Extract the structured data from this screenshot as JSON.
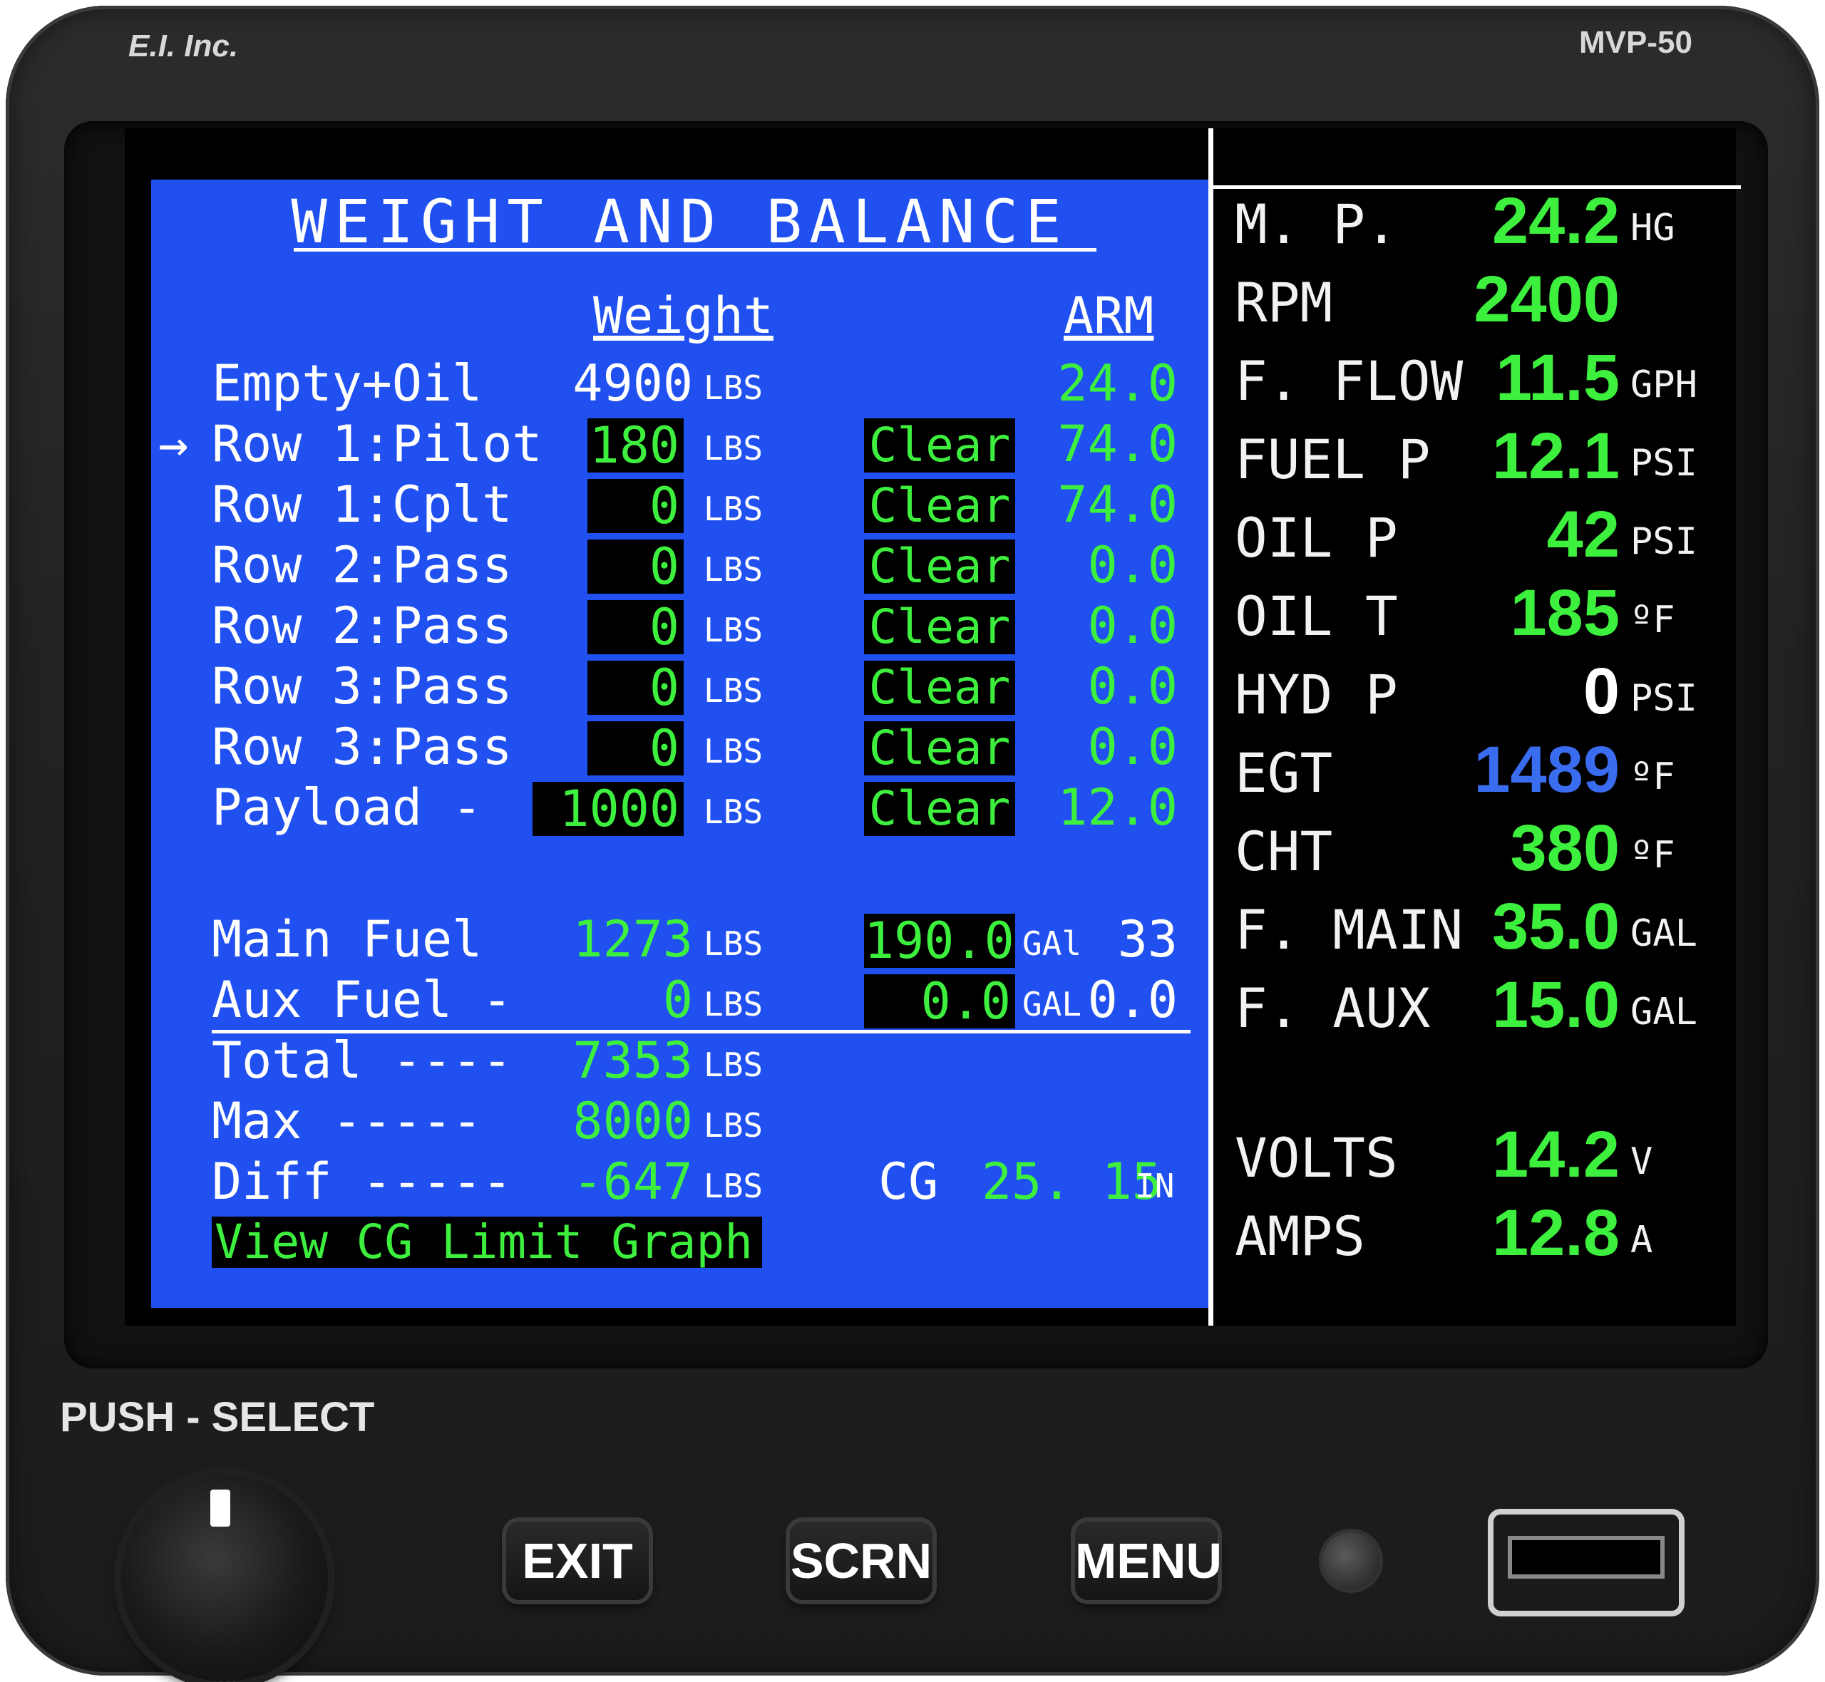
{
  "device": {
    "brand": "E.I. Inc.",
    "model": "MVP-50"
  },
  "wb": {
    "title": "WEIGHT AND BALANCE",
    "col_weight": "Weight",
    "col_arm": "ARM",
    "unit_lbs": "LBS",
    "rows": [
      {
        "label": "Empty+Oil",
        "weight": "4900",
        "editable": false,
        "clear": "",
        "arm": "24.0"
      },
      {
        "label": "Row 1:Pilot",
        "weight": "180",
        "editable": true,
        "clear": "Clear",
        "arm": "74.0",
        "selected": true
      },
      {
        "label": "Row 1:Cplt",
        "weight": "0",
        "editable": true,
        "clear": "Clear",
        "arm": "74.0"
      },
      {
        "label": "Row 2:Pass",
        "weight": "0",
        "editable": true,
        "clear": "Clear",
        "arm": "0.0"
      },
      {
        "label": "Row 2:Pass",
        "weight": "0",
        "editable": true,
        "clear": "Clear",
        "arm": "0.0"
      },
      {
        "label": "Row 3:Pass",
        "weight": "0",
        "editable": true,
        "clear": "Clear",
        "arm": "0.0"
      },
      {
        "label": "Row 3:Pass",
        "weight": "0",
        "editable": true,
        "clear": "Clear",
        "arm": "0.0"
      },
      {
        "label": "Payload -",
        "weight": "1000",
        "editable": true,
        "clear": "Clear",
        "arm": "12.0"
      }
    ],
    "cursor": "→",
    "main_fuel": {
      "label": "Main Fuel",
      "weight": "1273",
      "gal": "190.0",
      "gal_unit": "GAl",
      "arm": "33"
    },
    "aux_fuel": {
      "label": "Aux Fuel -",
      "weight": "0",
      "gal": "0.0",
      "gal_unit": "GAL",
      "arm": "0.0"
    },
    "total": {
      "label": "Total ----",
      "value": "7353"
    },
    "max": {
      "label": "Max -----",
      "value": "8000"
    },
    "diff": {
      "label": "Diff -----",
      "value": "-647"
    },
    "cg": {
      "label": "CG",
      "value": "25. 15",
      "unit": "IN"
    },
    "graph_button": "View CG Limit Graph"
  },
  "engine": [
    {
      "label": "M. P.",
      "value": "24.2",
      "unit": "HG",
      "color": "#3ef03e"
    },
    {
      "label": "RPM",
      "value": "2400",
      "unit": "",
      "color": "#3ef03e"
    },
    {
      "label": "F. FLOW",
      "value": "11.5",
      "unit": "GPH",
      "color": "#3ef03e"
    },
    {
      "label": "FUEL P",
      "value": "12.1",
      "unit": "PSI",
      "color": "#3ef03e"
    },
    {
      "label": "OIL P",
      "value": "42",
      "unit": "PSI",
      "color": "#3ef03e"
    },
    {
      "label": "OIL T",
      "value": "185",
      "unit": "ºF",
      "color": "#3ef03e"
    },
    {
      "label": "HYD P",
      "value": "0",
      "unit": "PSI",
      "color": "#ffffff"
    },
    {
      "label": "EGT",
      "value": "1489",
      "unit": "ºF",
      "color": "#3a6cf0"
    },
    {
      "label": "CHT",
      "value": "380",
      "unit": "ºF",
      "color": "#3ef03e"
    },
    {
      "label": "F. MAIN",
      "value": "35.0",
      "unit": "GAL",
      "color": "#3ef03e"
    },
    {
      "label": "F. AUX",
      "value": "15.0",
      "unit": "GAL",
      "color": "#3ef03e"
    },
    {
      "label": "VOLTS",
      "value": "14.2",
      "unit": "V",
      "color": "#3ef03e"
    },
    {
      "label": "AMPS",
      "value": "12.8",
      "unit": "A",
      "color": "#3ef03e"
    }
  ],
  "controls": {
    "push_select": "PUSH - SELECT",
    "exit": "EXIT",
    "scrn": "SCRN",
    "menu": "MENU"
  }
}
